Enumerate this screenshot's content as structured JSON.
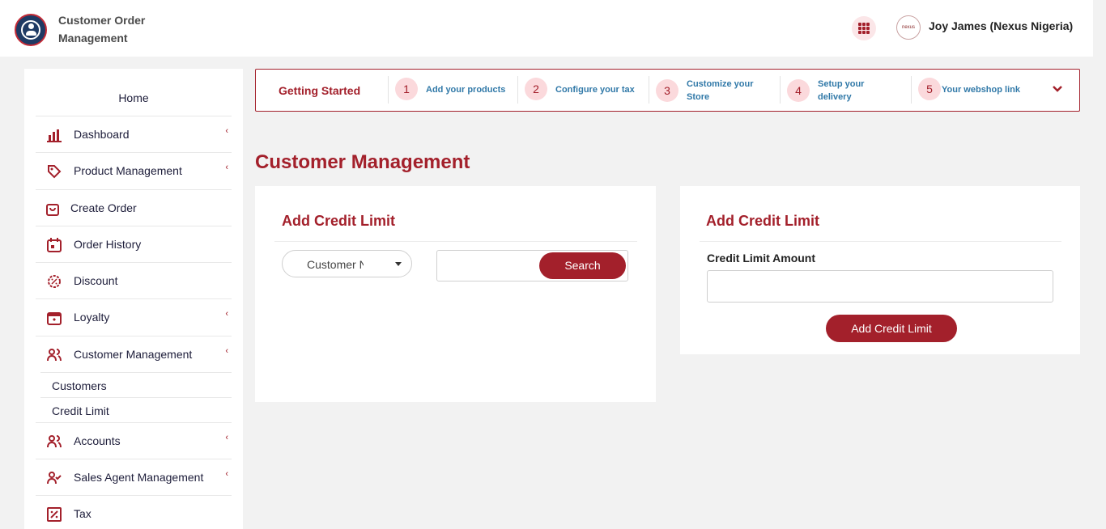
{
  "header": {
    "app_title": "Customer Order Management",
    "user_name": "Joy James (Nexus Nigeria)",
    "avatar_text": "nexus"
  },
  "sidebar": {
    "home": "Home",
    "items": [
      {
        "label": "Dashboard",
        "icon": "bar-chart-icon",
        "has_submenu": true
      },
      {
        "label": "Product Management",
        "icon": "tag-icon",
        "has_submenu": true
      },
      {
        "label": "Create Order",
        "icon": "shopping-bag-icon",
        "has_submenu": false
      },
      {
        "label": "Order History",
        "icon": "calendar-icon",
        "has_submenu": false
      },
      {
        "label": "Discount",
        "icon": "badge-percent-icon",
        "has_submenu": false
      },
      {
        "label": "Loyalty",
        "icon": "gift-box-icon",
        "has_submenu": true
      },
      {
        "label": "Customer Management",
        "icon": "users-icon",
        "has_submenu": true
      },
      {
        "label": "Accounts",
        "icon": "users-icon",
        "has_submenu": true
      },
      {
        "label": "Sales Agent Management",
        "icon": "user-check-icon",
        "has_submenu": true
      },
      {
        "label": "Tax",
        "icon": "percent-square-icon",
        "has_submenu": false
      }
    ],
    "sub_items": [
      {
        "label": "Customers"
      },
      {
        "label": "Credit Limit"
      }
    ],
    "chevron": "‹"
  },
  "getting_started": {
    "title": "Getting Started",
    "steps": [
      {
        "num": "1",
        "label": "Add your products"
      },
      {
        "num": "2",
        "label": "Configure your tax"
      },
      {
        "num": "3",
        "label": "Customize your Store"
      },
      {
        "num": "4",
        "label": "Setup your delivery"
      },
      {
        "num": "5",
        "label": "Your webshop link"
      }
    ]
  },
  "page_title": "Customer Management",
  "left_card": {
    "title": "Add Credit Limit",
    "select_value": "Customer Name",
    "search_value": "",
    "search_button": "Search"
  },
  "right_card": {
    "title": "Add Credit Limit",
    "field_label": "Credit Limit Amount",
    "field_value": "",
    "submit_button": "Add Credit Limit"
  },
  "colors": {
    "accent": "#a3202b",
    "step_badge_bg": "#fbd9dc",
    "step_text": "#3179a8",
    "page_bg": "#f2f2f2"
  }
}
